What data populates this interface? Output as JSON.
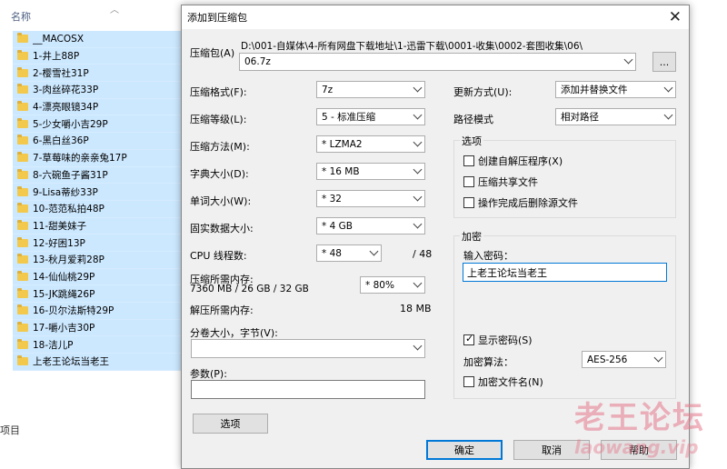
{
  "explorer": {
    "column_name": "名称",
    "status": "项目",
    "files": [
      "__MACOSX",
      "1-井上88P",
      "2-樱雪社31P",
      "3-肉丝碎花33P",
      "4-漂亮眼镜34P",
      "5-少女嚼小吉29P",
      "6-黑白丝36P",
      "7-草莓味的亲亲兔17P",
      "8-六碗鱼子酱31P",
      "9-Lisa蒂纱33P",
      "10-范范私拍48P",
      "11-甜美妹子",
      "12-好困13P",
      "13-秋月爱莉28P",
      "14-仙仙桃29P",
      "15-JK跳绳26P",
      "16-贝尔法斯特29P",
      "17-嚼小吉30P",
      "18-洁儿P",
      "上老王论坛当老王"
    ]
  },
  "dialog": {
    "title": "添加到压缩包",
    "archive_label": "压缩包(A)",
    "archive_path": "D:\\001-自媒体\\4-所有网盘下载地址\\1-迅雷下载\\0001-收集\\0002-套图收集\\06\\",
    "archive_name": "06.7z",
    "browse": "...",
    "format_label": "压缩格式(F):",
    "format_value": "7z",
    "level_label": "压缩等级(L):",
    "level_value": "5 - 标准压缩",
    "method_label": "压缩方法(M):",
    "method_value": "* LZMA2",
    "dict_label": "字典大小(D):",
    "dict_value": "* 16 MB",
    "word_label": "单词大小(W):",
    "word_value": "* 32",
    "solid_label": "固实数据大小:",
    "solid_value": "* 4 GB",
    "cpu_label": "CPU 线程数:",
    "cpu_value": "* 48",
    "cpu_total": "/ 48",
    "mem_label": "压缩所需内存:",
    "mem_detail": "7360 MB / 26 GB / 32 GB",
    "mem_value": "* 80%",
    "decomp_label": "解压所需内存:",
    "decomp_value": "18 MB",
    "split_label": "分卷大小，字节(V):",
    "params_label": "参数(P):",
    "options_button": "选项",
    "update_label": "更新方式(U):",
    "update_value": "添加并替换文件",
    "path_label": "路径模式",
    "path_value": "相对路径",
    "options_group": "选项",
    "opt_sfx": "创建自解压程序(X)",
    "opt_shared": "压缩共享文件",
    "opt_delete": "操作完成后删除源文件",
    "encrypt_group": "加密",
    "password_label": "输入密码：",
    "password_value": "上老王论坛当老王",
    "show_password": "显示密码(S)",
    "enc_method_label": "加密算法：",
    "enc_method_value": "AES-256",
    "enc_names": "加密文件名(N)",
    "ok": "确定",
    "cancel": "取消",
    "help": "帮助"
  },
  "watermark": {
    "line1": "老王论坛",
    "line2": "laowang.vip"
  }
}
